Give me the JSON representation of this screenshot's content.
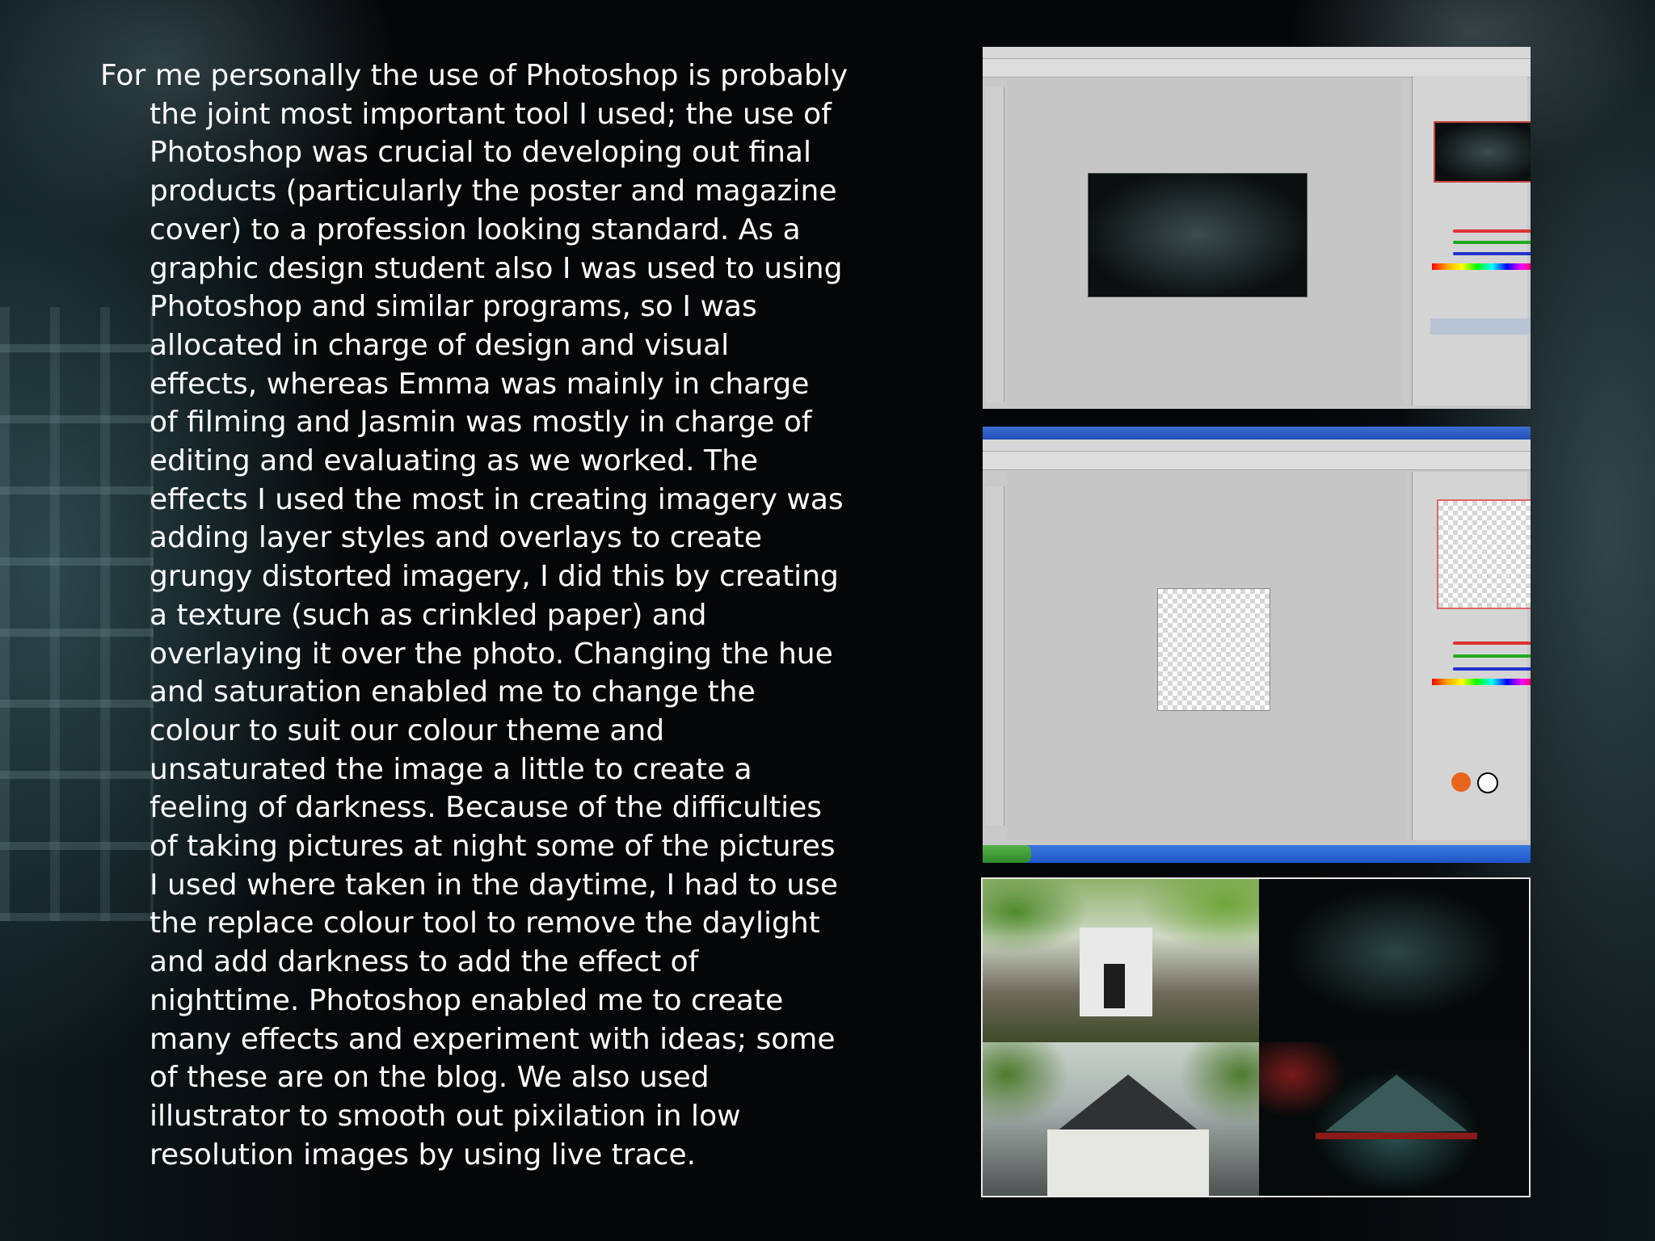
{
  "slide": {
    "body_text": "For me personally the use of Photoshop is probably\nthe joint most important tool I used; the use of\nPhotoshop was crucial to developing out final\nproducts (particularly the poster and magazine\ncover) to a profession looking standard. As a\ngraphic design student also I was used to using\nPhotoshop and similar programs, so I was\nallocated in charge of design and visual\neffects, whereas Emma was mainly in charge\nof filming and Jasmin was mostly in charge of\nediting and evaluating as we worked. The\neffects I used the most in creating imagery was\nadding layer styles and overlays to create\ngrungy distorted imagery, I did this by creating\na texture (such as crinkled paper) and\noverlaying it over the photo. Changing the hue\nand saturation enabled me to change the\ncolour to suit our colour theme and\nunsaturated the image a little to create a\nfeeling of darkness. Because of the difficulties\nof taking pictures at night some of the pictures\nI used where taken in the daytime, I had to use\nthe replace colour tool to remove the daylight\nand add darkness to add the effect of\nnighttime. Photoshop enabled me to create\nmany effects and experiment with ideas; some\nof these are on the blog. We also used\nillustrator to smooth out pixilation in low\nresolution images by using live trace."
  },
  "colors": {
    "text": "#ffffff",
    "background": "#050607",
    "background_texture": "#4a6a70",
    "frame_border": "#e8e8e8"
  },
  "images": [
    "photoshop-screenshot-1",
    "photoshop-screenshot-2",
    "before-after-photo-grid"
  ]
}
